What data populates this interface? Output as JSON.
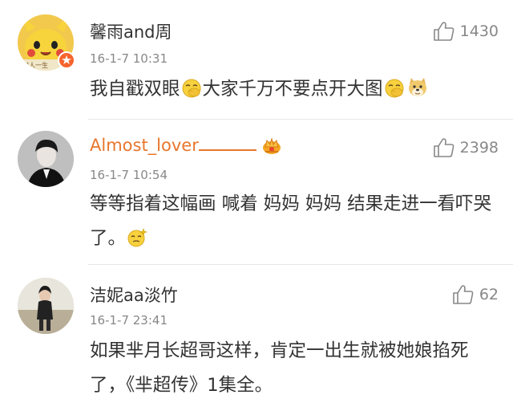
{
  "comments": [
    {
      "username": "馨雨and周",
      "avatar_text": "时人一生",
      "timestamp": "16-1-7 10:31",
      "likes": "1430",
      "content": "我自戳双眼"
    },
    {
      "username": "Almost_lover",
      "timestamp": "16-1-7 10:54",
      "likes": "2398",
      "content": "等等指着这幅画 喊着 妈妈 妈妈 结果走进一看吓哭了。"
    },
    {
      "username": "洁妮aa淡竹",
      "timestamp": "16-1-7 23:41",
      "likes": "62",
      "content": "如果芈月长超哥这样，肯定一出生就被她娘掐死了，《芈超传》1集全。"
    }
  ],
  "comment_parts": {
    "c0_part2": "大家千万不要点开大图"
  },
  "colors": {
    "vip_orange": "#e8762d",
    "text": "#333333",
    "meta": "#888888",
    "divider": "#e6e6e6"
  },
  "icons": {
    "like": "thumbs-up-icon",
    "vip": "vip-crown-icon",
    "emoji_a": "facepalm-emoji-icon",
    "emoji_b": "doge-emoji-icon",
    "emoji_c": "sparkle-face-emoji-icon"
  }
}
